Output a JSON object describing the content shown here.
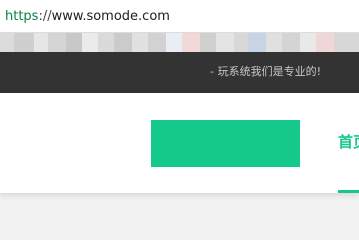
{
  "address_bar": {
    "scheme": "https",
    "separator": "://",
    "host": "www.somode.com"
  },
  "header": {
    "slogan": "- 玩系统我们是专业的!"
  },
  "nav": {
    "home_label": "首页"
  },
  "colors": {
    "accent": "#15c98b",
    "header_dark": "#333333",
    "scheme_green": "#0b8043"
  }
}
